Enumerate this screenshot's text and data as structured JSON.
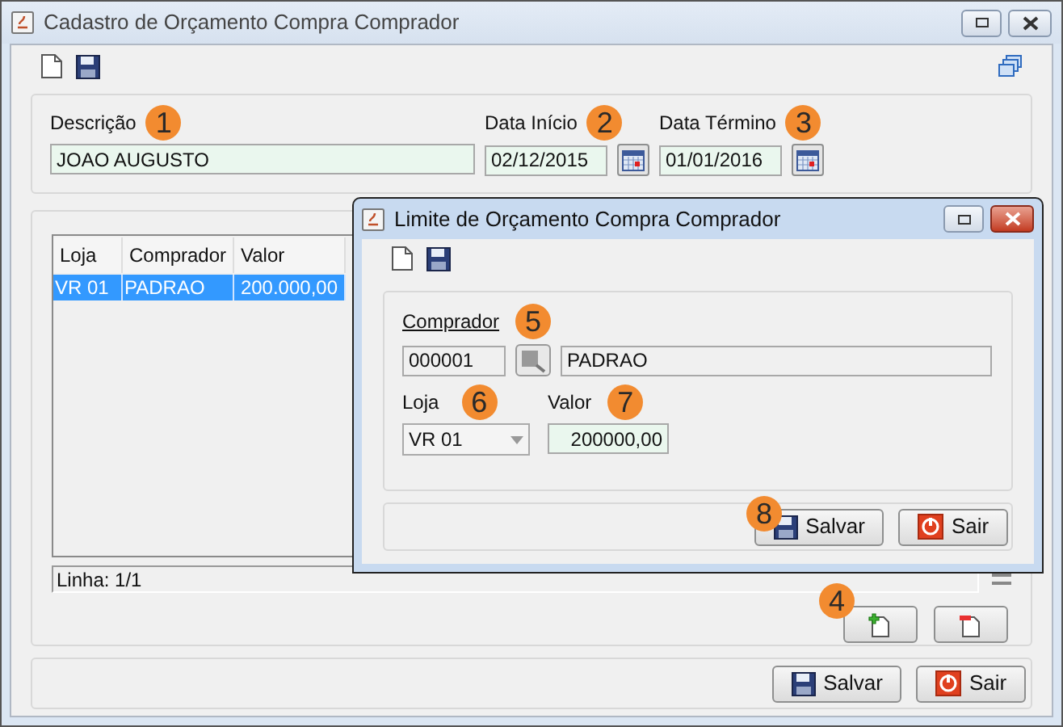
{
  "window": {
    "title": "Cadastro de Orçamento Compra Comprador"
  },
  "header_fields": [
    {
      "label": "Descrição",
      "badge": "1",
      "value": "JOAO AUGUSTO",
      "kind": "text"
    },
    {
      "label": "Data Início",
      "badge": "2",
      "value": "02/12/2015",
      "kind": "date"
    },
    {
      "label": "Data Término",
      "badge": "3",
      "value": "01/01/2016",
      "kind": "date"
    }
  ],
  "table": {
    "columns": [
      "Loja",
      "Comprador",
      "Valor"
    ],
    "rows": [
      {
        "cells": [
          "VR 01",
          "PADRAO",
          "200.000,00"
        ],
        "selected": true
      }
    ]
  },
  "status": "Linha: 1/1",
  "row_buttons_badge": "4",
  "footer_buttons": [
    {
      "label": "Salvar",
      "kind": "save"
    },
    {
      "label": "Sair",
      "kind": "exit"
    }
  ],
  "dialog": {
    "title": "Limite de Orçamento Compra Comprador",
    "comprador": {
      "label": "Comprador",
      "badge": "5",
      "code": "000001",
      "name": "PADRAO"
    },
    "loja": {
      "label": "Loja",
      "badge": "6",
      "value": "VR 01"
    },
    "valor": {
      "label": "Valor",
      "badge": "7",
      "value": "200000,00"
    },
    "buttons_badge": "8",
    "buttons": [
      {
        "label": "Salvar",
        "kind": "save"
      },
      {
        "label": "Sair",
        "kind": "exit"
      }
    ]
  }
}
